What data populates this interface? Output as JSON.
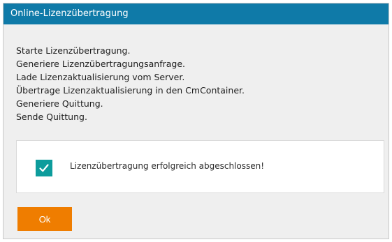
{
  "dialog": {
    "title": "Online-Lizenzübertragung",
    "log_lines": [
      "Starte Lizenzübertragung.",
      "Generiere Lizenzübertragungsanfrage.",
      "Lade Lizenzaktualisierung vom Server.",
      "Übertrage Lizenzaktualisierung in den CmContainer.",
      "Generiere Quittung.",
      "Sende Quittung."
    ],
    "result": {
      "icon": "checkmark-icon",
      "message": "Lizenzübertragung erfolgreich abgeschlossen!"
    },
    "ok_label": "Ok"
  },
  "colors": {
    "titlebar": "#0f7aa8",
    "checkbox": "#0d9c9c",
    "ok_button": "#ef7d00"
  }
}
